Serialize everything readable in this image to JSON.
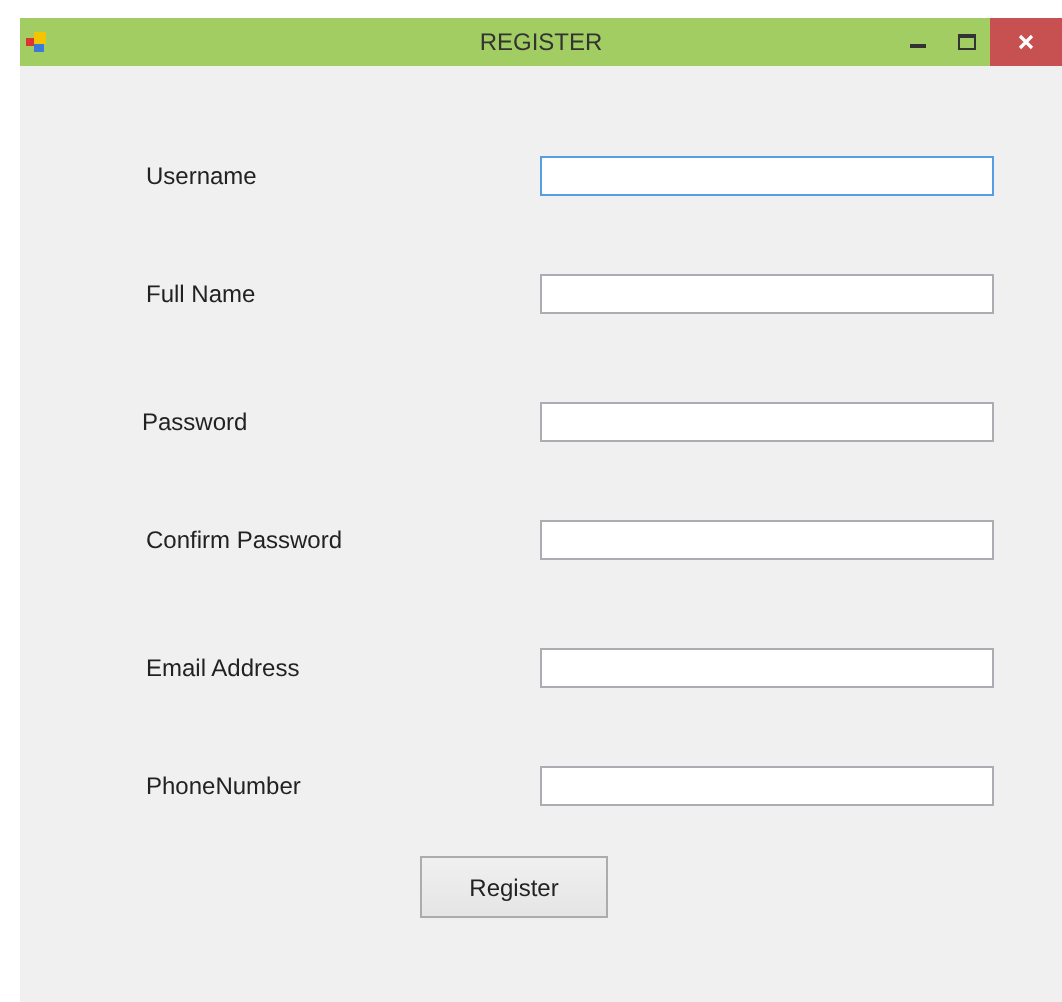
{
  "window": {
    "title": "REGISTER"
  },
  "fields": [
    {
      "label": "Username",
      "focused": true
    },
    {
      "label": "Full Name",
      "focused": false
    },
    {
      "label": "Password",
      "focused": false
    },
    {
      "label": "Confirm Password",
      "focused": false
    },
    {
      "label": "Email Address",
      "focused": false
    },
    {
      "label": "PhoneNumber",
      "focused": false
    }
  ],
  "buttons": [
    {
      "label": "Register"
    }
  ]
}
